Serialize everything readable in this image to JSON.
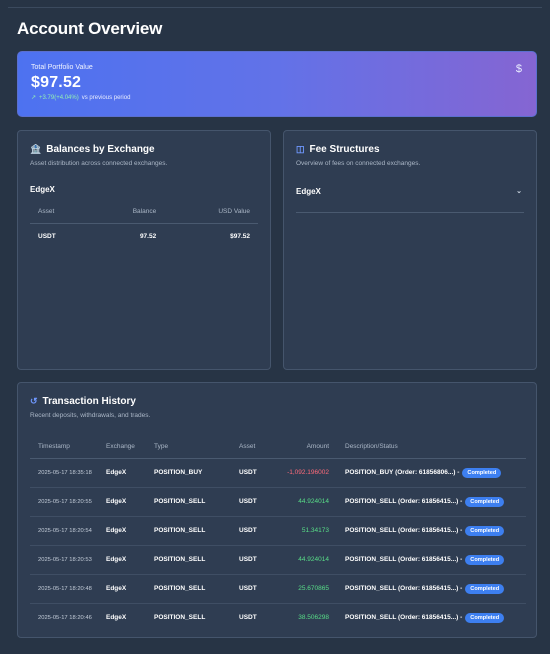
{
  "page": {
    "title": "Account Overview"
  },
  "portfolio": {
    "label": "Total Portfolio Value",
    "value": "$97.52",
    "change": "+3.79(+4.04%)",
    "period": "vs previous period",
    "icon": "dollar-icon"
  },
  "balances": {
    "title": "Balances by Exchange",
    "subtitle": "Asset distribution across connected exchanges.",
    "exchange": "EdgeX",
    "headers": [
      "Asset",
      "Balance",
      "USD Value"
    ],
    "rows": [
      {
        "asset": "USDT",
        "balance": "97.52",
        "usd": "$97.52"
      }
    ]
  },
  "fees": {
    "title": "Fee Structures",
    "subtitle": "Overview of fees on connected exchanges.",
    "exchange": "EdgeX"
  },
  "transactions": {
    "title": "Transaction History",
    "subtitle": "Recent deposits, withdrawals, and trades.",
    "headers": [
      "Timestamp",
      "Exchange",
      "Type",
      "Asset",
      "Amount",
      "Description/Status"
    ],
    "rows": [
      {
        "ts": "2025-05-17 18:35:18",
        "exchange": "EdgeX",
        "type": "POSITION_BUY",
        "asset": "USDT",
        "amount": "-1,092.196002",
        "desc": "POSITION_BUY (Order: 61856806...) -",
        "status": "Completed"
      },
      {
        "ts": "2025-05-17 18:20:55",
        "exchange": "EdgeX",
        "type": "POSITION_SELL",
        "asset": "USDT",
        "amount": "44.924014",
        "desc": "POSITION_SELL (Order: 61856415...) -",
        "status": "Completed"
      },
      {
        "ts": "2025-05-17 18:20:54",
        "exchange": "EdgeX",
        "type": "POSITION_SELL",
        "asset": "USDT",
        "amount": "51.34173",
        "desc": "POSITION_SELL (Order: 61856415...) -",
        "status": "Completed"
      },
      {
        "ts": "2025-05-17 18:20:53",
        "exchange": "EdgeX",
        "type": "POSITION_SELL",
        "asset": "USDT",
        "amount": "44.924014",
        "desc": "POSITION_SELL (Order: 61856415...) -",
        "status": "Completed"
      },
      {
        "ts": "2025-05-17 18:20:48",
        "exchange": "EdgeX",
        "type": "POSITION_SELL",
        "asset": "USDT",
        "amount": "25.670865",
        "desc": "POSITION_SELL (Order: 61856415...) -",
        "status": "Completed"
      },
      {
        "ts": "2025-05-17 18:20:46",
        "exchange": "EdgeX",
        "type": "POSITION_SELL",
        "asset": "USDT",
        "amount": "38.506298",
        "desc": "POSITION_SELL (Order: 61856415...) -",
        "status": "Completed"
      }
    ]
  },
  "colors": {
    "positive": "#58de88",
    "negative": "#ff6b7a",
    "accent": "#3d7ff0"
  }
}
